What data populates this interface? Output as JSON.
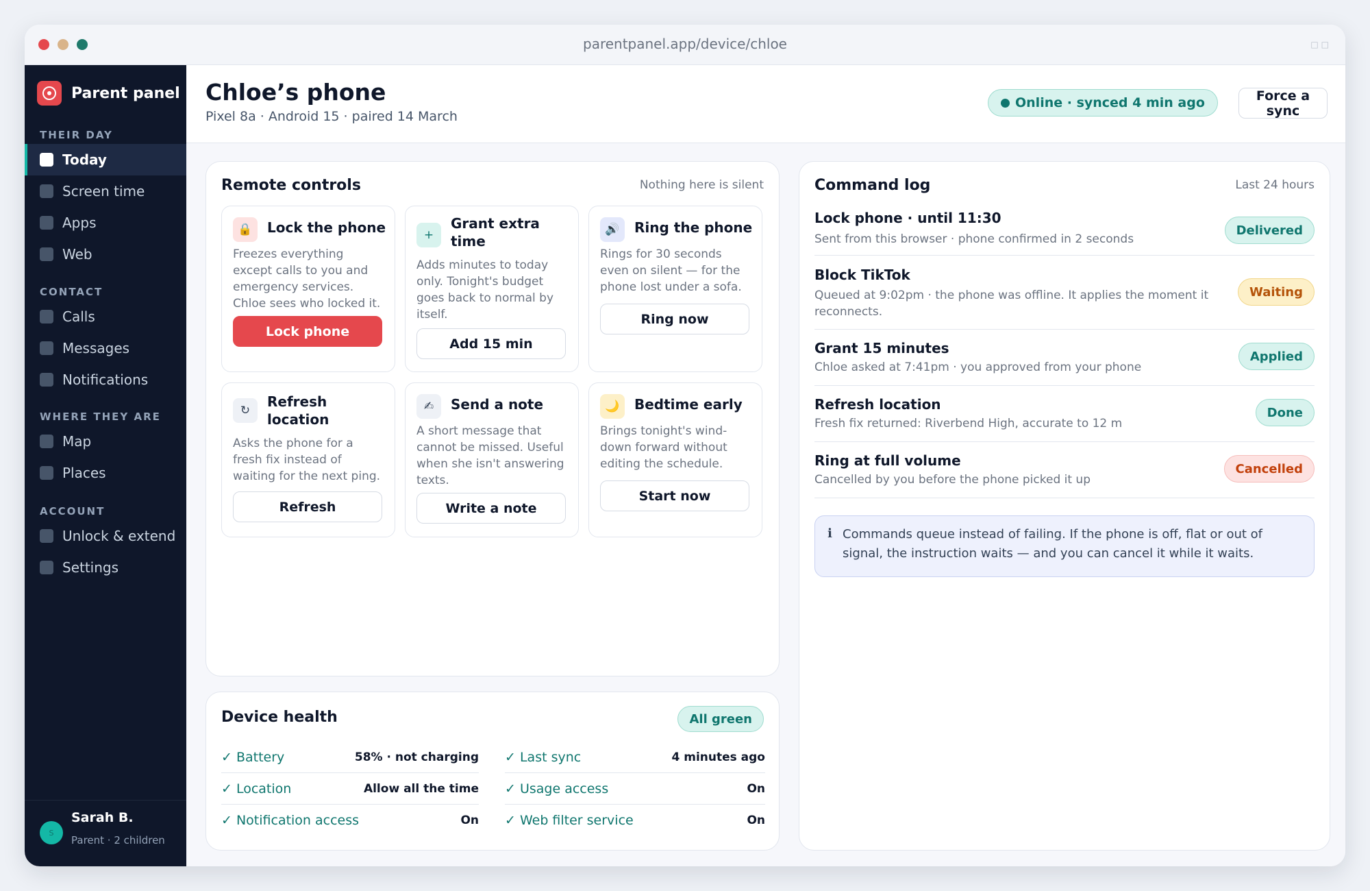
{
  "window": {
    "url": "parentpanel.app/device/chloe"
  },
  "sidebar": {
    "brand": "Parent panel",
    "sections": [
      {
        "label": "THEIR DAY",
        "items": [
          {
            "label": "Today",
            "active": true
          },
          {
            "label": "Screen time"
          },
          {
            "label": "Apps"
          },
          {
            "label": "Web"
          }
        ]
      },
      {
        "label": "CONTACT",
        "items": [
          {
            "label": "Calls"
          },
          {
            "label": "Messages"
          },
          {
            "label": "Notifications"
          }
        ]
      },
      {
        "label": "WHERE THEY ARE",
        "items": [
          {
            "label": "Map"
          },
          {
            "label": "Places"
          }
        ]
      },
      {
        "label": "ACCOUNT",
        "items": [
          {
            "label": "Unlock & extend"
          },
          {
            "label": "Settings"
          }
        ]
      }
    ],
    "user": {
      "initial": "S",
      "name": "Sarah B.",
      "role": "Parent · 2 children"
    }
  },
  "header": {
    "title": "Chloe’s phone",
    "subtitle": "Pixel 8a · Android 15 · paired 14 March",
    "status": "Online · synced 4 min ago",
    "force_sync": "Force a sync"
  },
  "remote": {
    "title": "Remote controls",
    "note": "Nothing here is silent",
    "tiles": [
      {
        "icon": "lock-icon",
        "title": "Lock the phone",
        "desc": "Freezes everything except calls to you and emergency services. Chloe sees who locked it.",
        "button": "Lock phone"
      },
      {
        "icon": "plus-icon",
        "title": "Grant extra time",
        "desc": "Adds minutes to today only. Tonight's budget goes back to normal by itself.",
        "button": "Add 15 min"
      },
      {
        "icon": "speaker-icon",
        "title": "Ring the phone",
        "desc": "Rings for 30 seconds even on silent — for the phone lost under a sofa.",
        "button": "Ring now"
      },
      {
        "icon": "refresh-icon",
        "title": "Refresh location",
        "desc": "Asks the phone for a fresh fix instead of waiting for the next ping.",
        "button": "Refresh"
      },
      {
        "icon": "pen-icon",
        "title": "Send a note",
        "desc": "A short message that cannot be missed. Useful when she isn't answering texts.",
        "button": "Write a note"
      },
      {
        "icon": "moon-icon",
        "title": "Bedtime early",
        "desc": "Brings tonight's wind-down forward without editing the schedule.",
        "button": "Start now"
      }
    ]
  },
  "health": {
    "title": "Device health",
    "badge": "All green",
    "left": [
      {
        "label": "✓ Battery",
        "value": "58% · not charging"
      },
      {
        "label": "✓ Location",
        "value": "Allow all the time"
      },
      {
        "label": "✓ Notification access",
        "value": "On"
      }
    ],
    "right": [
      {
        "label": "✓ Last sync",
        "value": "4 minutes ago"
      },
      {
        "label": "✓ Usage access",
        "value": "On"
      },
      {
        "label": "✓ Web filter service",
        "value": "On"
      }
    ]
  },
  "log": {
    "title": "Command log",
    "note": "Last 24 hours",
    "entries": [
      {
        "title": "Lock phone · until 11:30",
        "detail": "Sent from this browser · phone confirmed in 2 seconds",
        "status": "Delivered",
        "kind": "delivered"
      },
      {
        "title": "Block TikTok",
        "detail": "Queued at 9:02pm · the phone was offline. It applies the moment it reconnects.",
        "status": "Waiting",
        "kind": "waiting"
      },
      {
        "title": "Grant 15 minutes",
        "detail": "Chloe asked at 7:41pm · you approved from your phone",
        "status": "Applied",
        "kind": "applied"
      },
      {
        "title": "Refresh location",
        "detail": "Fresh fix returned: Riverbend High, accurate to 12 m",
        "status": "Done",
        "kind": "done"
      },
      {
        "title": "Ring at full volume",
        "detail": "Cancelled by you before the phone picked it up",
        "status": "Cancelled",
        "kind": "cancelled"
      }
    ],
    "info": "Commands queue instead of failing. If the phone is off, flat or out of signal, the instruction waits — and you can cancel it while it waits."
  },
  "colors": {
    "accent": "#e5484d",
    "teal": "#0f766e",
    "sidebar": "#0f172a",
    "waiting": "#b45309"
  }
}
